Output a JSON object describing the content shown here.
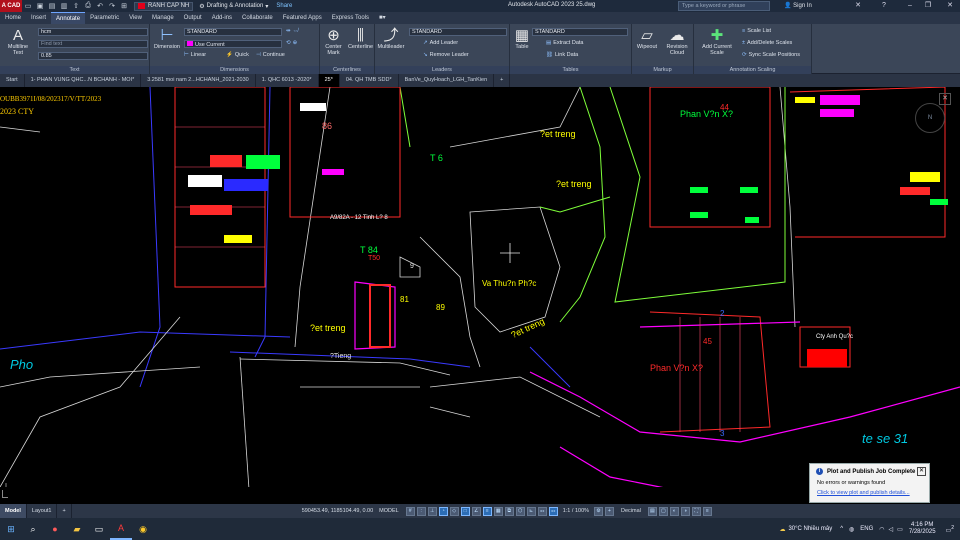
{
  "titlebar": {
    "app_logo": "A CAD",
    "layer_name": "RANH CAP NH",
    "workspace": "Drafting & Annotation",
    "share": "Share",
    "title": "Autodesk AutoCAD 2023   25.dwg",
    "search_placeholder": "Type a keyword or phrase",
    "signin": "Sign In"
  },
  "menu_tabs": [
    "Home",
    "Insert",
    "Annotate",
    "Parametric",
    "View",
    "Manage",
    "Output",
    "Add-ins",
    "Collaborate",
    "Featured Apps",
    "Express Tools",
    "■▾"
  ],
  "active_menu_tab": "Annotate",
  "ribbon": {
    "text": {
      "label": "Text",
      "multiline": "Multiline Text",
      "style": "hcm",
      "find": "Find text",
      "height": "0.85"
    },
    "dimensions": {
      "label": "Dimensions",
      "dimension": "Dimension",
      "style": "STANDARD",
      "layer": "Use Current",
      "linear": "Linear",
      "quick": "Quick",
      "continue": "Continue"
    },
    "centerlines": {
      "label": "Centerlines",
      "center_mark": "Center Mark",
      "centerline": "Centerline"
    },
    "leaders": {
      "label": "Leaders",
      "multileader": "Multileader",
      "style": "STANDARD",
      "add": "Add Leader",
      "remove": "Remove Leader"
    },
    "tables": {
      "label": "Tables",
      "table": "Table",
      "style": "STANDARD",
      "extract": "Extract Data",
      "link": "Link Data"
    },
    "markup": {
      "label": "Markup",
      "wipeout": "Wipeout",
      "revision": "Revision Cloud"
    },
    "scaling": {
      "label": "Annotation Scaling",
      "add_scale": "Add Current Scale",
      "scale_list": "Scale List",
      "add_delete": "Add/Delete Scales",
      "sync": "Sync Scale Positions"
    }
  },
  "doc_tabs": [
    "Start",
    "1- PHAN VUNG QHC...N BCHANH - MOI*",
    "3.2581 moi nam 2...HCHANH_2021-2030",
    "1. QHC 6013 -2020*",
    "25*",
    "04. QH TMB SDD*",
    "BanVe_QuyHoach_LGH_TanKien"
  ],
  "active_doc_tab": "25*",
  "canvas_text": {
    "top_left_1": "OUBB3971I/08/202317/V/TT/2023",
    "top_left_2": "2023 CTY",
    "left_road": "Pho",
    "right_bottom": "te se 31",
    "parcel_86": "86",
    "parcel_9": "9",
    "parcel_81": "81",
    "parcel_89": "89",
    "parcel_45": "45",
    "parcel_44": "44",
    "parcel_2": "2",
    "parcel_3": "3",
    "text_phanvan": "Phan V?n X?",
    "text_ettreng": "?et treng",
    "text_tieng": "?Tieng",
    "text_vathuan": "Va Thu?n Ph?c",
    "text_t84": "T 84",
    "text_t6": "T 6",
    "text_cty": "Cty Anh Qu?c",
    "text_a9": "A9/82A - 12 Tinh L? 8",
    "text_t50": "T50"
  },
  "statusbar": {
    "tabs": [
      "Model",
      "Layout1"
    ],
    "active_tab": "Model",
    "coords": "590453.49, 1185104.49, 0.00",
    "space": "MODEL",
    "scale": "1:1 / 100%",
    "units": "Decimal"
  },
  "toast": {
    "title": "Plot and Publish Job Complete",
    "message": "No errors or warnings found",
    "link": "Click to view plot and publish details..."
  },
  "taskbar": {
    "weather": "30°C  Nhiều mây",
    "lang": "ENG",
    "time": "4:16 PM",
    "date": "7/28/2025",
    "notifications": "2"
  },
  "colors": {
    "accent": "#6ea5ff",
    "cad_red": "#ff2a2a",
    "cad_green": "#00ff3c",
    "cad_magenta": "#ff00ff",
    "cad_yellow": "#ffff00",
    "cad_blue": "#3a3aff",
    "cad_cyan": "#00e5ff"
  }
}
